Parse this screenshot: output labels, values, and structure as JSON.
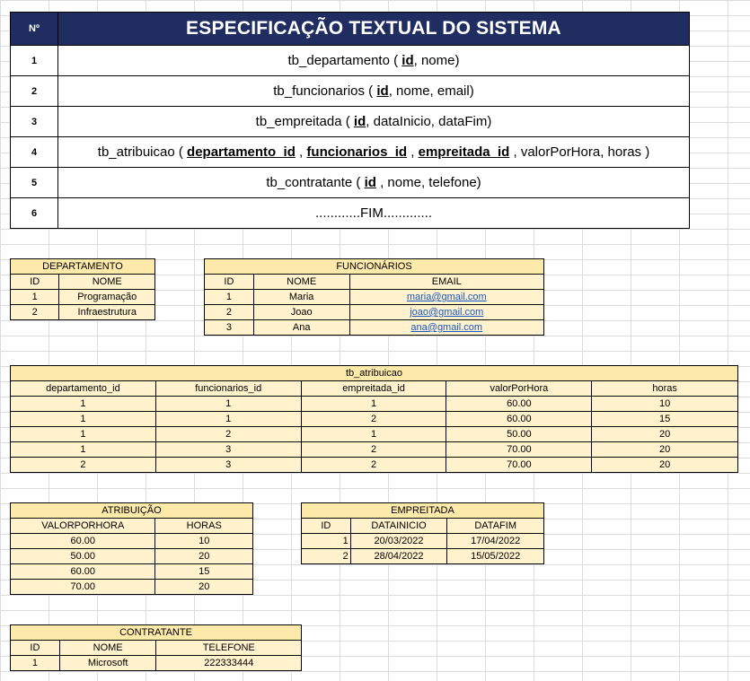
{
  "spec": {
    "header_num": "Nº",
    "title": "ESPECIFICAÇÃO TEXTUAL DO SISTEMA",
    "rows": [
      {
        "n": "1",
        "name": "tb_departamento",
        "open": " ( ",
        "keys": [
          "id"
        ],
        "rest": ", nome)"
      },
      {
        "n": "2",
        "name": "tb_funcionarios",
        "open": " ( ",
        "keys": [
          "id"
        ],
        "rest": ", nome, email)"
      },
      {
        "n": "3",
        "name": "tb_empreitada",
        "open": " ( ",
        "keys": [
          "id"
        ],
        "rest": ", dataInicio, dataFim)"
      },
      {
        "n": "4",
        "name": "tb_atribuicao",
        "open": " ( ",
        "keys": [
          "departamento_id",
          "funcionarios_id",
          "empreitada_id"
        ],
        "rest": " , valorPorHora, horas )"
      },
      {
        "n": "5",
        "name": "tb_contratante",
        "open": " ( ",
        "keys": [
          "id"
        ],
        "rest": " , nome, telefone)"
      },
      {
        "n": "6",
        "text": "............FIM............."
      }
    ]
  },
  "departamento": {
    "title": "DEPARTAMENTO",
    "headers": [
      "ID",
      "NOME"
    ],
    "rows": [
      [
        "1",
        "Programação"
      ],
      [
        "2",
        "Infraestrutura"
      ]
    ]
  },
  "funcionarios": {
    "title": "FUNCIONÁRIOS",
    "headers": [
      "ID",
      "NOME",
      "EMAIL"
    ],
    "rows": [
      [
        "1",
        "Maria",
        "maria@gmail.com"
      ],
      [
        "2",
        "Joao",
        "joao@gmail.com"
      ],
      [
        "3",
        "Ana",
        "ana@gmail.com"
      ]
    ]
  },
  "tb_atribuicao": {
    "title": "tb_atribuicao",
    "headers": [
      "departamento_id",
      "funcionarios_id",
      "empreitada_id",
      "valorPorHora",
      "horas"
    ],
    "rows": [
      [
        "1",
        "1",
        "1",
        "60.00",
        "10"
      ],
      [
        "1",
        "1",
        "2",
        "60.00",
        "15"
      ],
      [
        "1",
        "2",
        "1",
        "50.00",
        "20"
      ],
      [
        "1",
        "3",
        "2",
        "70.00",
        "20"
      ],
      [
        "2",
        "3",
        "2",
        "70.00",
        "20"
      ]
    ]
  },
  "atribuicao": {
    "title": "ATRIBUIÇÃO",
    "headers": [
      "VALORPORHORA",
      "HORAS"
    ],
    "rows": [
      [
        "60.00",
        "10"
      ],
      [
        "50.00",
        "20"
      ],
      [
        "60.00",
        "15"
      ],
      [
        "70.00",
        "20"
      ]
    ]
  },
  "empreitada": {
    "title": "EMPREITADA",
    "headers": [
      "ID",
      "DATAINICIO",
      "DATAFIM"
    ],
    "rows": [
      [
        "1",
        "20/03/2022",
        "17/04/2022"
      ],
      [
        "2",
        "28/04/2022",
        "15/05/2022"
      ]
    ]
  },
  "contratante": {
    "title": "CONTRATANTE",
    "headers": [
      "ID",
      "NOME",
      "TELEFONE"
    ],
    "rows": [
      [
        "1",
        "Microsoft",
        "222333444"
      ]
    ]
  }
}
